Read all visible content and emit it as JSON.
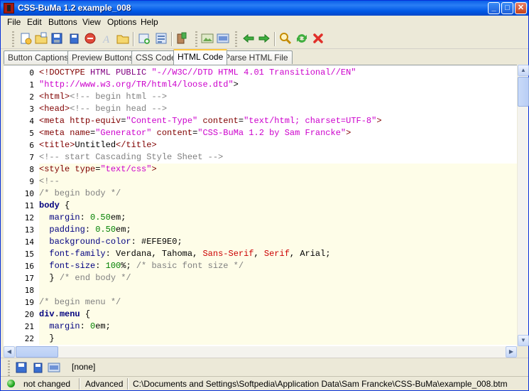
{
  "window": {
    "title": "CSS-BuMa 1.2  example_008"
  },
  "menu": [
    "File",
    "Edit",
    "Buttons",
    "View",
    "Options",
    "Help"
  ],
  "toolbar": {
    "icons": [
      "new-document-icon",
      "open-folder-icon",
      "save-icon",
      "save-all-icon",
      "stop-icon",
      "font-icon",
      "folder-icon",
      "add-button-icon",
      "properties-icon",
      "export-icon",
      "image-icon",
      "preview-icon",
      "back-arrow-icon",
      "forward-arrow-icon",
      "search-icon",
      "refresh-icon",
      "delete-icon"
    ]
  },
  "tabs": [
    {
      "label": "Button Captions",
      "active": false
    },
    {
      "label": "Preview Buttons",
      "active": false
    },
    {
      "label": "CSS Code",
      "active": false
    },
    {
      "label": "HTML Code",
      "active": true
    },
    {
      "label": "Parse HTML File",
      "active": false
    }
  ],
  "editor": {
    "lines": [
      {
        "n": "0",
        "text": "<!DOCTYPE HTML PUBLIC \"-//W3C//DTD HTML 4.01 Transitional//EN\""
      },
      {
        "n": "1",
        "text": "\"http://www.w3.org/TR/html4/loose.dtd\">"
      },
      {
        "n": "2",
        "text": "<html><!-- begin html -->"
      },
      {
        "n": "3",
        "text": "<head><!-- begin head -->"
      },
      {
        "n": "4",
        "text": "<meta http-equiv=\"Content-Type\" content=\"text/html; charset=UTF-8\">"
      },
      {
        "n": "5",
        "text": "<meta name=\"Generator\" content=\"CSS-BuMa 1.2 by Sam Francke\">"
      },
      {
        "n": "6",
        "text": "<title>Untitled</title>"
      },
      {
        "n": "7",
        "text": "<!-- start Cascading Style Sheet -->"
      },
      {
        "n": "8",
        "text": "<style type=\"text/css\">"
      },
      {
        "n": "9",
        "text": "<!--"
      },
      {
        "n": "10",
        "text": "/* begin body */"
      },
      {
        "n": "11",
        "text": "body {"
      },
      {
        "n": "12",
        "text": "  margin: 0.50em;"
      },
      {
        "n": "13",
        "text": "  padding: 0.50em;"
      },
      {
        "n": "14",
        "text": "  background-color: #EFE9E0;"
      },
      {
        "n": "15",
        "text": "  font-family: Verdana, Tahoma, Sans-Serif, Serif, Arial;"
      },
      {
        "n": "16",
        "text": "  font-size: 100%; /* basic font size */"
      },
      {
        "n": "17",
        "text": "  } /* end body */"
      },
      {
        "n": "18",
        "text": ""
      },
      {
        "n": "19",
        "text": "/* begin menu */"
      },
      {
        "n": "20",
        "text": "div.menu {"
      },
      {
        "n": "21",
        "text": "  margin: 0em;"
      },
      {
        "n": "22",
        "text": "  }"
      }
    ]
  },
  "bottom": {
    "selection": "[none]"
  },
  "status": {
    "state": "not changed",
    "mode": "Advanced",
    "path": "C:\\Documents and Settings\\Softpedia\\Application Data\\Sam Francke\\CSS-BuMa\\example_008.btm"
  },
  "colors": {
    "titlebar": "#0058e6",
    "window_bg": "#ece9d8",
    "css_line_bg": "#fefde8",
    "tag": "#800000",
    "string": "#cc00cc",
    "comment": "#808080"
  }
}
